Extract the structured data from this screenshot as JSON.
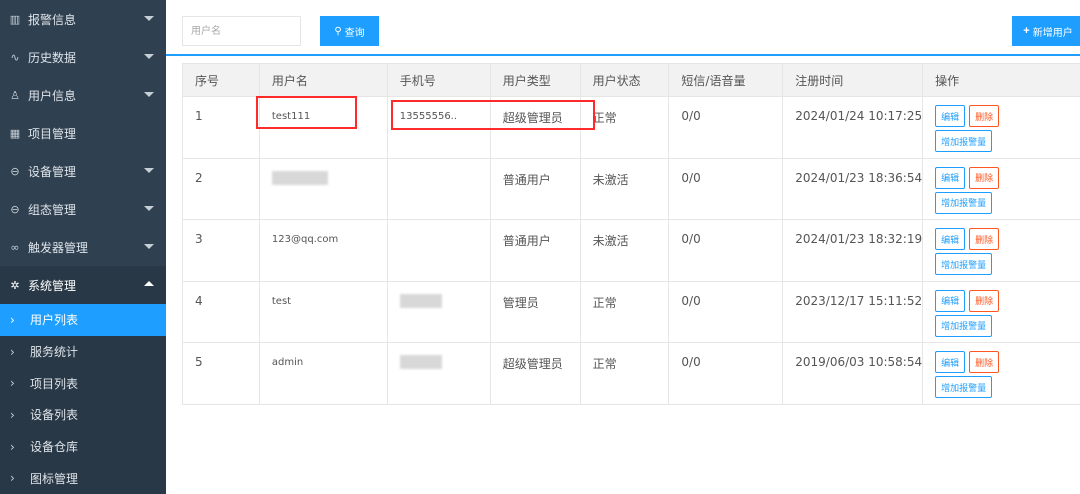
{
  "sidebar": {
    "menu": [
      {
        "label": "报警信息",
        "icon": "bar-icon"
      },
      {
        "label": "历史数据",
        "icon": "pulse-icon"
      },
      {
        "label": "用户信息",
        "icon": "user-icon"
      },
      {
        "label": "项目管理",
        "icon": "grid-icon"
      },
      {
        "label": "设备管理",
        "icon": "device-icon"
      },
      {
        "label": "组态管理",
        "icon": "config-icon"
      },
      {
        "label": "触发器管理",
        "icon": "link-icon"
      },
      {
        "label": "系统管理",
        "icon": "gear-icon"
      }
    ],
    "submenu": [
      {
        "label": "用户列表"
      },
      {
        "label": "服务统计"
      },
      {
        "label": "项目列表"
      },
      {
        "label": "设备列表"
      },
      {
        "label": "设备仓库"
      },
      {
        "label": "图标管理"
      }
    ]
  },
  "toolbar": {
    "search_placeholder": "用户名",
    "query_label": "查询",
    "add_label": "新增用户"
  },
  "table": {
    "headers": [
      "序号",
      "用户名",
      "手机号",
      "用户类型",
      "用户状态",
      "短信/语音量",
      "注册时间",
      "操作"
    ],
    "rows": [
      {
        "no": "1",
        "username": "test111",
        "phone": "13555556..",
        "type": "超级管理员",
        "status": "正常",
        "quota": "0/0",
        "time": "2024/01/24 10:17:25"
      },
      {
        "no": "2",
        "username": "",
        "phone": "",
        "type": "普通用户",
        "status": "未激活",
        "quota": "0/0",
        "time": "2024/01/23 18:36:54"
      },
      {
        "no": "3",
        "username": "123@qq.com",
        "phone": "",
        "type": "普通用户",
        "status": "未激活",
        "quota": "0/0",
        "time": "2024/01/23 18:32:19"
      },
      {
        "no": "4",
        "username": "test",
        "phone": "",
        "type": "管理员",
        "status": "正常",
        "quota": "0/0",
        "time": "2023/12/17 15:11:52"
      },
      {
        "no": "5",
        "username": "admin",
        "phone": "",
        "type": "超级管理员",
        "status": "正常",
        "quota": "0/0",
        "time": "2019/06/03 10:58:54"
      }
    ],
    "actions": {
      "edit": "编辑",
      "delete": "删除",
      "add_alarm": "增加报警量"
    }
  },
  "colors": {
    "primary": "#1e9fff",
    "danger": "#ff5722",
    "sidebar": "#2f4050",
    "highlight": "#ff2a2a"
  }
}
